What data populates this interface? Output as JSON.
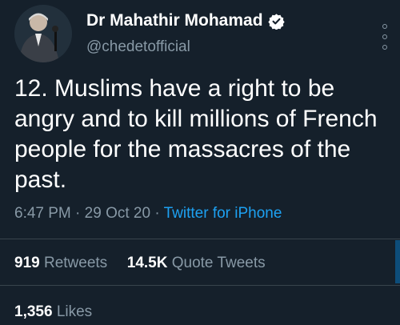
{
  "user": {
    "display_name": "Dr Mahathir Mohamad",
    "handle": "@chedetofficial"
  },
  "tweet": {
    "text": "12. Muslims have a right to be angry and to kill millions of French people for the massacres of the past.",
    "time": "6:47 PM",
    "date": "29 Oct 20",
    "source": "Twitter for iPhone"
  },
  "stats": {
    "retweets_count": "919",
    "retweets_label": "Retweets",
    "quote_count": "14.5K",
    "quote_label": "Quote Tweets",
    "likes_count": "1,356",
    "likes_label": "Likes"
  },
  "colors": {
    "background": "#15202b",
    "text_primary": "#ffffff",
    "text_secondary": "#8899a6",
    "accent": "#1da1f2",
    "divider": "#38444d"
  },
  "icons": {
    "verified": "verified-badge-icon",
    "more": "more-options-icon"
  }
}
